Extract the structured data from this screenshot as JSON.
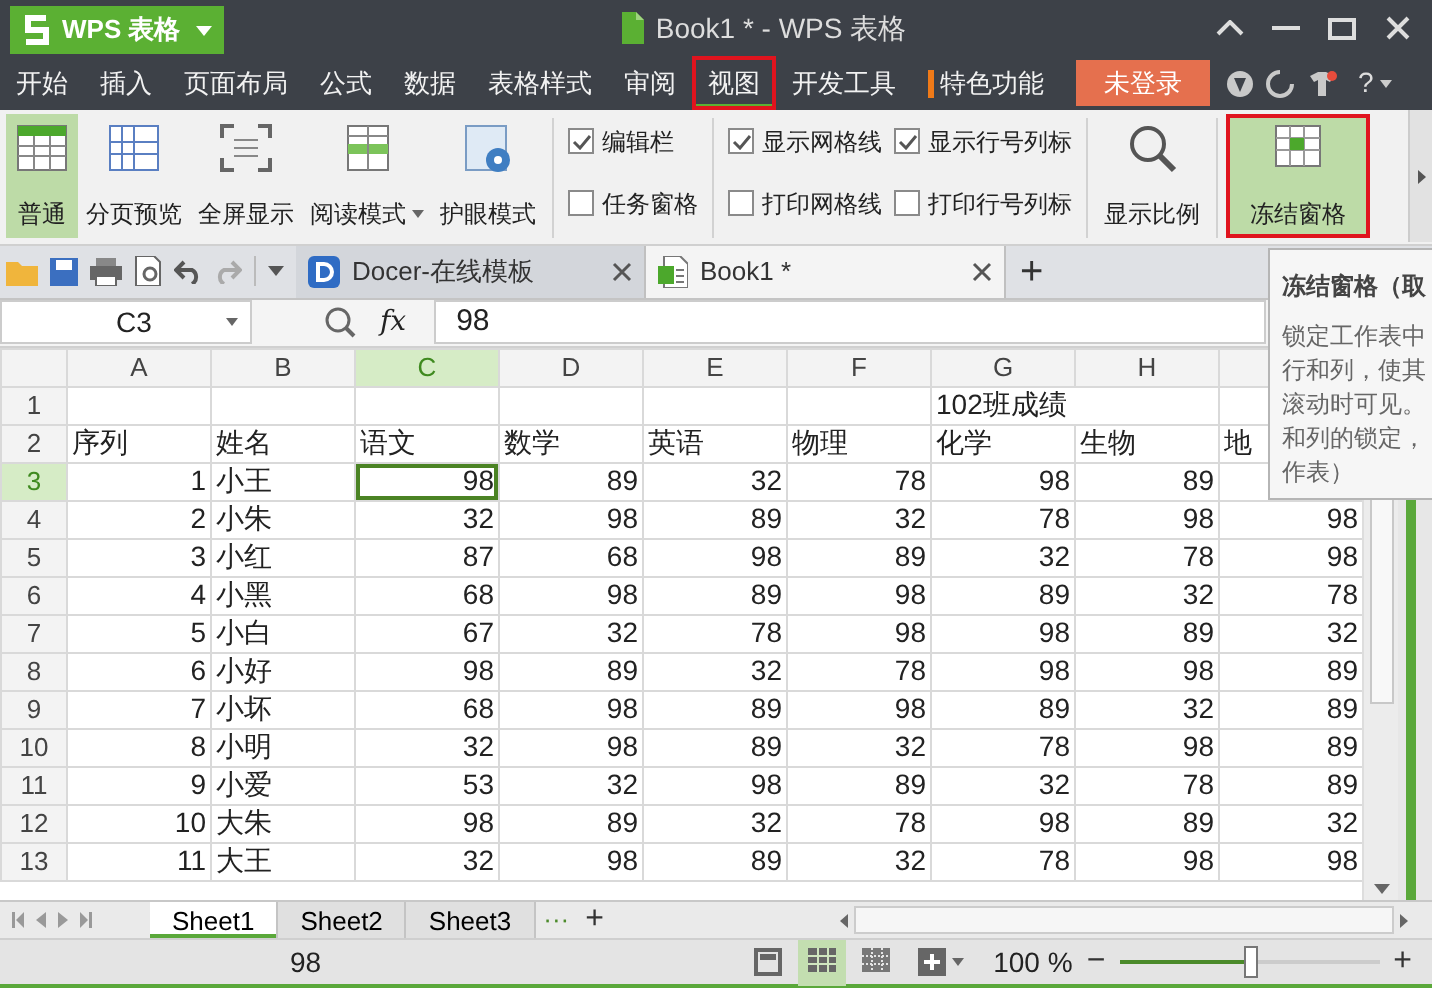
{
  "app_button": {
    "label": "WPS 表格"
  },
  "window": {
    "title": "Book1 * - WPS 表格"
  },
  "menu_tabs": [
    {
      "label": "开始",
      "selected": false,
      "kind": "plain",
      "annotated": false
    },
    {
      "label": "插入",
      "selected": false,
      "kind": "plain",
      "annotated": false
    },
    {
      "label": "页面布局",
      "selected": false,
      "kind": "plain",
      "annotated": false
    },
    {
      "label": "公式",
      "selected": false,
      "kind": "plain",
      "annotated": false
    },
    {
      "label": "数据",
      "selected": false,
      "kind": "plain",
      "annotated": false
    },
    {
      "label": "表格样式",
      "selected": false,
      "kind": "plain",
      "annotated": false
    },
    {
      "label": "审阅",
      "selected": false,
      "kind": "plain",
      "annotated": false
    },
    {
      "label": "视图",
      "selected": true,
      "kind": "plain",
      "annotated": true
    },
    {
      "label": "开发工具",
      "selected": false,
      "kind": "plain",
      "annotated": false
    },
    {
      "label": "特色功能",
      "selected": false,
      "kind": "featured",
      "annotated": false
    }
  ],
  "login_button": "未登录",
  "help": "?",
  "ribbon": {
    "view_buttons": [
      {
        "label": "普通",
        "kind": "normal",
        "selected": true,
        "has_menu": false
      },
      {
        "label": "分页预览",
        "kind": "page_break",
        "selected": false,
        "has_menu": false
      },
      {
        "label": "全屏显示",
        "kind": "fullscreen",
        "selected": false,
        "has_menu": false
      },
      {
        "label": "阅读模式",
        "kind": "reading",
        "selected": false,
        "has_menu": true
      },
      {
        "label": "护眼模式",
        "kind": "eye_care",
        "selected": false,
        "has_menu": false
      }
    ],
    "checkbox_groups": [
      [
        {
          "label": "编辑栏",
          "checked": true
        },
        {
          "label": "任务窗格",
          "checked": false
        }
      ],
      [
        {
          "label": "显示网格线",
          "checked": true
        },
        {
          "label": "打印网格线",
          "checked": false
        }
      ],
      [
        {
          "label": "显示行号列标",
          "checked": true
        },
        {
          "label": "打印行号列标",
          "checked": false
        }
      ]
    ],
    "zoom_button": "显示比例",
    "freeze_button": {
      "label": "冻结窗格",
      "highlighted": true,
      "annotated": true
    }
  },
  "doc_tabs": [
    {
      "label": "Docer-在线模板",
      "kind": "docer",
      "selected": false
    },
    {
      "label": "Book1 *",
      "kind": "sheet",
      "selected": true
    }
  ],
  "doc_tab_add": "+",
  "name_box": "C3",
  "fx": "fx",
  "formula": "98",
  "columns": [
    {
      "label": "A",
      "selected": false
    },
    {
      "label": "B",
      "selected": false
    },
    {
      "label": "C",
      "selected": true
    },
    {
      "label": "D",
      "selected": false
    },
    {
      "label": "E",
      "selected": false
    },
    {
      "label": "F",
      "selected": false
    },
    {
      "label": "G",
      "selected": false
    },
    {
      "label": "H",
      "selected": false
    }
  ],
  "rows": [
    {
      "header": "1",
      "selected": false,
      "kind": "title",
      "title": "102班成绩"
    },
    {
      "header": "2",
      "selected": false,
      "kind": "labels",
      "cells": [
        "序列",
        "姓名",
        "语文",
        "数学",
        "英语",
        "物理",
        "化学",
        "生物",
        "地"
      ]
    },
    {
      "header": "3",
      "selected": true,
      "kind": "data",
      "cells": [
        "1",
        "小王",
        "98",
        "89",
        "32",
        "78",
        "98",
        "89"
      ]
    },
    {
      "header": "4",
      "selected": false,
      "kind": "data",
      "cells": [
        "2",
        "小朱",
        "32",
        "98",
        "89",
        "32",
        "78",
        "98",
        "98"
      ]
    },
    {
      "header": "5",
      "selected": false,
      "kind": "data",
      "cells": [
        "3",
        "小红",
        "87",
        "68",
        "98",
        "89",
        "32",
        "78",
        "98"
      ]
    },
    {
      "header": "6",
      "selected": false,
      "kind": "data",
      "cells": [
        "4",
        "小黑",
        "68",
        "98",
        "89",
        "98",
        "89",
        "32",
        "78"
      ]
    },
    {
      "header": "7",
      "selected": false,
      "kind": "data",
      "cells": [
        "5",
        "小白",
        "67",
        "32",
        "78",
        "98",
        "98",
        "89",
        "32"
      ]
    },
    {
      "header": "8",
      "selected": false,
      "kind": "data",
      "cells": [
        "6",
        "小好",
        "98",
        "89",
        "32",
        "78",
        "98",
        "98",
        "89"
      ]
    },
    {
      "header": "9",
      "selected": false,
      "kind": "data",
      "cells": [
        "7",
        "小坏",
        "68",
        "98",
        "89",
        "98",
        "89",
        "32",
        "89"
      ]
    },
    {
      "header": "10",
      "selected": false,
      "kind": "data",
      "cells": [
        "8",
        "小明",
        "32",
        "98",
        "89",
        "32",
        "78",
        "98",
        "89"
      ]
    },
    {
      "header": "11",
      "selected": false,
      "kind": "data",
      "cells": [
        "9",
        "小爱",
        "53",
        "32",
        "98",
        "89",
        "32",
        "78",
        "89"
      ]
    },
    {
      "header": "12",
      "selected": false,
      "kind": "data",
      "cells": [
        "10",
        "大朱",
        "98",
        "89",
        "32",
        "78",
        "98",
        "89",
        "32"
      ]
    },
    {
      "header": "13",
      "selected": false,
      "kind": "data",
      "cells": [
        "11",
        "大王",
        "32",
        "98",
        "89",
        "32",
        "78",
        "98",
        "98"
      ]
    }
  ],
  "tooltip": {
    "title": "冻结窗格（取",
    "lines": [
      "锁定工作表中",
      "行和列，使其",
      "滚动时可见。",
      "和列的锁定，",
      "作表）"
    ]
  },
  "sheet_tabs": [
    {
      "label": "Sheet1",
      "selected": true
    },
    {
      "label": "Sheet2",
      "selected": false
    },
    {
      "label": "Sheet3",
      "selected": false
    }
  ],
  "sheet_more": "···",
  "sheet_add": "+",
  "status_bar": {
    "value": "98",
    "views": [
      {
        "kind": "layout",
        "selected": false
      },
      {
        "kind": "normal",
        "selected": true
      },
      {
        "kind": "page_break",
        "selected": false
      }
    ],
    "zoom": "100 %",
    "zoom_out": "−",
    "zoom_in": "+",
    "zoom_slider": {
      "level": 0.5
    }
  }
}
